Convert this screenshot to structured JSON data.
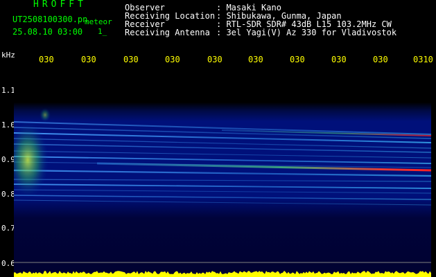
{
  "logo": "HROFFT",
  "file": {
    "name": "UT2508100300.pn",
    "datetime": "25.08.10 03:00",
    "mode": "meteor",
    "page_index": "1_"
  },
  "info": [
    {
      "label": "Observer",
      "value": ": Masaki Kano"
    },
    {
      "label": "Receiving Location",
      "value": ": Shibukawa, Gunma, Japan"
    },
    {
      "label": "Receiver",
      "value": ": RTL-SDR SDR# 43dB L15 103.2MHz CW"
    },
    {
      "label": "Receiving Antenna",
      "value": ": 3el Yagi(V) Az 330 for Vladivostok"
    }
  ],
  "y_unit": "kHz",
  "y_ticks": [
    "1.1",
    "1.0",
    "0.9",
    "0.8",
    "0.7",
    "0.6"
  ],
  "x_ticks": [
    "030",
    "030",
    "030",
    "030",
    "030",
    "030",
    "030",
    "030",
    "030",
    "0310"
  ],
  "colors": {
    "background": "#000000",
    "header_text": "#ffffff",
    "logo_text": "#00ff00",
    "tick_text": "#ffff00",
    "spectrum_low": "#00006a",
    "spectrum_mid": "#3fa0ff",
    "spectrum_high": "#ff2020",
    "amplitude": "#ffff00"
  }
}
